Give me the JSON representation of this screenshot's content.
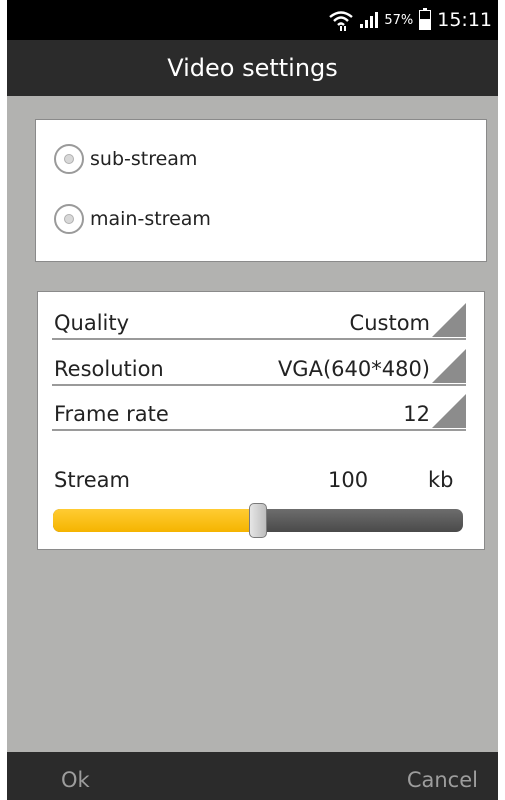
{
  "status_bar": {
    "battery_percent": "57%",
    "battery_level": 0.57,
    "time": "15:11",
    "icons": [
      "wifi-icon",
      "signal-icon",
      "battery-icon"
    ]
  },
  "title_bar": {
    "title": "Video settings"
  },
  "stream_type": {
    "options": [
      {
        "label": "sub-stream",
        "selected": false
      },
      {
        "label": "main-stream",
        "selected": false
      }
    ]
  },
  "settings": {
    "quality": {
      "label": "Quality",
      "value": "Custom"
    },
    "resolution": {
      "label": "Resolution",
      "value": "VGA(640*480)"
    },
    "frame_rate": {
      "label": "Frame rate",
      "value": "12"
    },
    "stream": {
      "label": "Stream",
      "value": "100",
      "unit": "kb",
      "slider_fraction": 0.5
    }
  },
  "bottom_bar": {
    "ok_label": "Ok",
    "cancel_label": "Cancel"
  },
  "colors": {
    "background": "#b2b2b0",
    "bars": "#2b2b2b",
    "slider_accent": "#f5b400",
    "slider_track": "#555555",
    "button_text": "#9d9d9d"
  }
}
